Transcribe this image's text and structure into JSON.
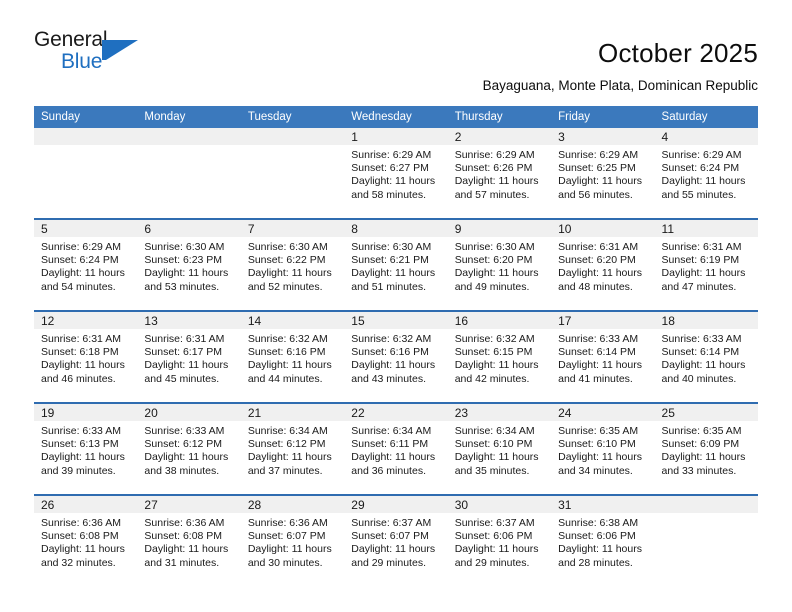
{
  "logo": {
    "word_top": "General",
    "word_bottom": "Blue",
    "mark_name": "blue-flag-triangle"
  },
  "header": {
    "title": "October 2025",
    "subtitle": "Bayaguana, Monte Plata, Dominican Republic"
  },
  "colors": {
    "header_blue": "#3b79bd",
    "row_rule_blue": "#2f6cb0",
    "daynum_strip": "#f0f0f0",
    "logo_blue": "#1f6fc0"
  },
  "calendar": {
    "weekday_headers": [
      "Sunday",
      "Monday",
      "Tuesday",
      "Wednesday",
      "Thursday",
      "Friday",
      "Saturday"
    ],
    "weeks": [
      [
        {
          "day": "",
          "empty": true,
          "sunrise": "",
          "sunset": "",
          "daylight_line1": "",
          "daylight_line2": ""
        },
        {
          "day": "",
          "empty": true,
          "sunrise": "",
          "sunset": "",
          "daylight_line1": "",
          "daylight_line2": ""
        },
        {
          "day": "",
          "empty": true,
          "sunrise": "",
          "sunset": "",
          "daylight_line1": "",
          "daylight_line2": ""
        },
        {
          "day": "1",
          "empty": false,
          "sunrise": "Sunrise: 6:29 AM",
          "sunset": "Sunset: 6:27 PM",
          "daylight_line1": "Daylight: 11 hours",
          "daylight_line2": "and 58 minutes."
        },
        {
          "day": "2",
          "empty": false,
          "sunrise": "Sunrise: 6:29 AM",
          "sunset": "Sunset: 6:26 PM",
          "daylight_line1": "Daylight: 11 hours",
          "daylight_line2": "and 57 minutes."
        },
        {
          "day": "3",
          "empty": false,
          "sunrise": "Sunrise: 6:29 AM",
          "sunset": "Sunset: 6:25 PM",
          "daylight_line1": "Daylight: 11 hours",
          "daylight_line2": "and 56 minutes."
        },
        {
          "day": "4",
          "empty": false,
          "sunrise": "Sunrise: 6:29 AM",
          "sunset": "Sunset: 6:24 PM",
          "daylight_line1": "Daylight: 11 hours",
          "daylight_line2": "and 55 minutes."
        }
      ],
      [
        {
          "day": "5",
          "empty": false,
          "sunrise": "Sunrise: 6:29 AM",
          "sunset": "Sunset: 6:24 PM",
          "daylight_line1": "Daylight: 11 hours",
          "daylight_line2": "and 54 minutes."
        },
        {
          "day": "6",
          "empty": false,
          "sunrise": "Sunrise: 6:30 AM",
          "sunset": "Sunset: 6:23 PM",
          "daylight_line1": "Daylight: 11 hours",
          "daylight_line2": "and 53 minutes."
        },
        {
          "day": "7",
          "empty": false,
          "sunrise": "Sunrise: 6:30 AM",
          "sunset": "Sunset: 6:22 PM",
          "daylight_line1": "Daylight: 11 hours",
          "daylight_line2": "and 52 minutes."
        },
        {
          "day": "8",
          "empty": false,
          "sunrise": "Sunrise: 6:30 AM",
          "sunset": "Sunset: 6:21 PM",
          "daylight_line1": "Daylight: 11 hours",
          "daylight_line2": "and 51 minutes."
        },
        {
          "day": "9",
          "empty": false,
          "sunrise": "Sunrise: 6:30 AM",
          "sunset": "Sunset: 6:20 PM",
          "daylight_line1": "Daylight: 11 hours",
          "daylight_line2": "and 49 minutes."
        },
        {
          "day": "10",
          "empty": false,
          "sunrise": "Sunrise: 6:31 AM",
          "sunset": "Sunset: 6:20 PM",
          "daylight_line1": "Daylight: 11 hours",
          "daylight_line2": "and 48 minutes."
        },
        {
          "day": "11",
          "empty": false,
          "sunrise": "Sunrise: 6:31 AM",
          "sunset": "Sunset: 6:19 PM",
          "daylight_line1": "Daylight: 11 hours",
          "daylight_line2": "and 47 minutes."
        }
      ],
      [
        {
          "day": "12",
          "empty": false,
          "sunrise": "Sunrise: 6:31 AM",
          "sunset": "Sunset: 6:18 PM",
          "daylight_line1": "Daylight: 11 hours",
          "daylight_line2": "and 46 minutes."
        },
        {
          "day": "13",
          "empty": false,
          "sunrise": "Sunrise: 6:31 AM",
          "sunset": "Sunset: 6:17 PM",
          "daylight_line1": "Daylight: 11 hours",
          "daylight_line2": "and 45 minutes."
        },
        {
          "day": "14",
          "empty": false,
          "sunrise": "Sunrise: 6:32 AM",
          "sunset": "Sunset: 6:16 PM",
          "daylight_line1": "Daylight: 11 hours",
          "daylight_line2": "and 44 minutes."
        },
        {
          "day": "15",
          "empty": false,
          "sunrise": "Sunrise: 6:32 AM",
          "sunset": "Sunset: 6:16 PM",
          "daylight_line1": "Daylight: 11 hours",
          "daylight_line2": "and 43 minutes."
        },
        {
          "day": "16",
          "empty": false,
          "sunrise": "Sunrise: 6:32 AM",
          "sunset": "Sunset: 6:15 PM",
          "daylight_line1": "Daylight: 11 hours",
          "daylight_line2": "and 42 minutes."
        },
        {
          "day": "17",
          "empty": false,
          "sunrise": "Sunrise: 6:33 AM",
          "sunset": "Sunset: 6:14 PM",
          "daylight_line1": "Daylight: 11 hours",
          "daylight_line2": "and 41 minutes."
        },
        {
          "day": "18",
          "empty": false,
          "sunrise": "Sunrise: 6:33 AM",
          "sunset": "Sunset: 6:14 PM",
          "daylight_line1": "Daylight: 11 hours",
          "daylight_line2": "and 40 minutes."
        }
      ],
      [
        {
          "day": "19",
          "empty": false,
          "sunrise": "Sunrise: 6:33 AM",
          "sunset": "Sunset: 6:13 PM",
          "daylight_line1": "Daylight: 11 hours",
          "daylight_line2": "and 39 minutes."
        },
        {
          "day": "20",
          "empty": false,
          "sunrise": "Sunrise: 6:33 AM",
          "sunset": "Sunset: 6:12 PM",
          "daylight_line1": "Daylight: 11 hours",
          "daylight_line2": "and 38 minutes."
        },
        {
          "day": "21",
          "empty": false,
          "sunrise": "Sunrise: 6:34 AM",
          "sunset": "Sunset: 6:12 PM",
          "daylight_line1": "Daylight: 11 hours",
          "daylight_line2": "and 37 minutes."
        },
        {
          "day": "22",
          "empty": false,
          "sunrise": "Sunrise: 6:34 AM",
          "sunset": "Sunset: 6:11 PM",
          "daylight_line1": "Daylight: 11 hours",
          "daylight_line2": "and 36 minutes."
        },
        {
          "day": "23",
          "empty": false,
          "sunrise": "Sunrise: 6:34 AM",
          "sunset": "Sunset: 6:10 PM",
          "daylight_line1": "Daylight: 11 hours",
          "daylight_line2": "and 35 minutes."
        },
        {
          "day": "24",
          "empty": false,
          "sunrise": "Sunrise: 6:35 AM",
          "sunset": "Sunset: 6:10 PM",
          "daylight_line1": "Daylight: 11 hours",
          "daylight_line2": "and 34 minutes."
        },
        {
          "day": "25",
          "empty": false,
          "sunrise": "Sunrise: 6:35 AM",
          "sunset": "Sunset: 6:09 PM",
          "daylight_line1": "Daylight: 11 hours",
          "daylight_line2": "and 33 minutes."
        }
      ],
      [
        {
          "day": "26",
          "empty": false,
          "sunrise": "Sunrise: 6:36 AM",
          "sunset": "Sunset: 6:08 PM",
          "daylight_line1": "Daylight: 11 hours",
          "daylight_line2": "and 32 minutes."
        },
        {
          "day": "27",
          "empty": false,
          "sunrise": "Sunrise: 6:36 AM",
          "sunset": "Sunset: 6:08 PM",
          "daylight_line1": "Daylight: 11 hours",
          "daylight_line2": "and 31 minutes."
        },
        {
          "day": "28",
          "empty": false,
          "sunrise": "Sunrise: 6:36 AM",
          "sunset": "Sunset: 6:07 PM",
          "daylight_line1": "Daylight: 11 hours",
          "daylight_line2": "and 30 minutes."
        },
        {
          "day": "29",
          "empty": false,
          "sunrise": "Sunrise: 6:37 AM",
          "sunset": "Sunset: 6:07 PM",
          "daylight_line1": "Daylight: 11 hours",
          "daylight_line2": "and 29 minutes."
        },
        {
          "day": "30",
          "empty": false,
          "sunrise": "Sunrise: 6:37 AM",
          "sunset": "Sunset: 6:06 PM",
          "daylight_line1": "Daylight: 11 hours",
          "daylight_line2": "and 29 minutes."
        },
        {
          "day": "31",
          "empty": false,
          "sunrise": "Sunrise: 6:38 AM",
          "sunset": "Sunset: 6:06 PM",
          "daylight_line1": "Daylight: 11 hours",
          "daylight_line2": "and 28 minutes."
        },
        {
          "day": "",
          "empty": true,
          "sunrise": "",
          "sunset": "",
          "daylight_line1": "",
          "daylight_line2": ""
        }
      ]
    ]
  }
}
